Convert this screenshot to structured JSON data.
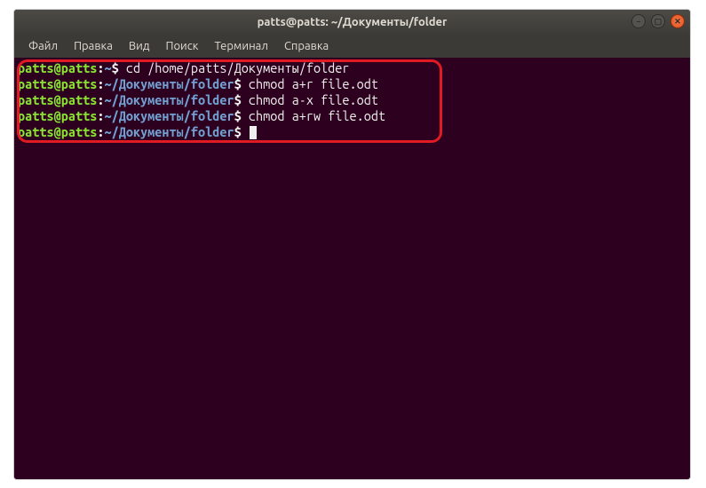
{
  "title": "patts@patts: ~/Документы/folder",
  "menu": {
    "file": "Файл",
    "edit": "Правка",
    "view": "Вид",
    "search": "Поиск",
    "terminal": "Терминал",
    "help": "Справка"
  },
  "prompt": {
    "user_host": "patts@patts",
    "home_path": "~",
    "folder_path": "~/Документы/folder",
    "colon": ":",
    "dollar": "$"
  },
  "lines": {
    "l1_cmd": " cd /home/patts/Документы/folder",
    "l2_cmd": " chmod a+r file.odt",
    "l3_cmd": " chmod a-x file.odt",
    "l4_cmd": " chmod a+rw file.odt",
    "l5_cmd": " "
  }
}
